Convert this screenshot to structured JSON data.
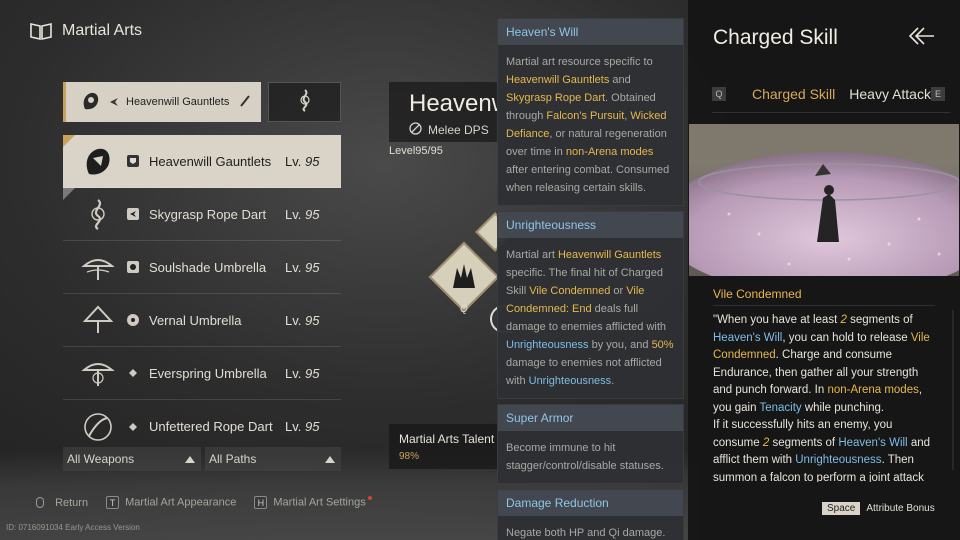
{
  "header": {
    "title": "Martial Arts"
  },
  "top_tab": {
    "label": "Heavenwill Gauntlets"
  },
  "weapons": [
    {
      "name": "Heavenwill Gauntlets",
      "lv_prefix": "Lv.",
      "lv": "95",
      "selected": true
    },
    {
      "name": "Skygrasp Rope Dart",
      "lv_prefix": "Lv.",
      "lv": "95"
    },
    {
      "name": "Soulshade Umbrella",
      "lv_prefix": "Lv.",
      "lv": "95"
    },
    {
      "name": "Vernal Umbrella",
      "lv_prefix": "Lv.",
      "lv": "95"
    },
    {
      "name": "Everspring Umbrella",
      "lv_prefix": "Lv.",
      "lv": "95"
    },
    {
      "name": "Unfettered Rope Dart",
      "lv_prefix": "Lv.",
      "lv": "95"
    }
  ],
  "filters": {
    "weapons": "All Weapons",
    "paths": "All Paths"
  },
  "hints": {
    "return": "Return",
    "appearance_key": "T",
    "appearance": "Martial Art Appearance",
    "settings_key": "H",
    "settings": "Martial Art Settings"
  },
  "build": "ID: 0716091034 Early Access Version",
  "center": {
    "title": "Heavenwill Gauntlets",
    "role": "Melee DPS",
    "level_label": "Level",
    "level_value": "95/95",
    "skill_key": "Q",
    "talent_label": "Martial Arts Talent",
    "talent_progress": "98%"
  },
  "tips": {
    "heavens_will": {
      "title": "Heaven's Will",
      "t1": "Martial art resource specific to ",
      "h1": "Heavenwill Gauntlets",
      "t2": " and ",
      "h2": "Skygrasp Rope Dart",
      "t3": ". Obtained through ",
      "h3": "Falcon's Pursuit",
      "t4": ", ",
      "h4": "Wicked Defiance",
      "t5": ", or natural regeneration over time in ",
      "h5": "non-Arena modes",
      "t6": " after entering combat. Consumed when releasing certain skills."
    },
    "unrighteousness": {
      "title": "Unrighteousness",
      "t1": "Martial art ",
      "h1": "Heavenwill Gauntlets",
      "t2": " specific. The final hit of Charged Skill ",
      "h2": "Vile Condemned",
      "t3": " or ",
      "h3": "Vile Condemned: End",
      "t4": " deals full damage to enemies afflicted with ",
      "h4": "Unrighteousness",
      "t5": " by you, and ",
      "h5": "50%",
      "t6": " damage to enemies not afflicted with ",
      "h6": "Unrighteousness",
      "t7": "."
    },
    "super_armor": {
      "title": "Super Armor",
      "body": "Become immune to hit stagger/control/disable statuses."
    },
    "damage_reduction": {
      "title": "Damage Reduction",
      "body": "Negate both HP and Qi damage."
    }
  },
  "right": {
    "title": "Charged Skill",
    "tab_key_left": "Q",
    "tab_active": "Charged Skill",
    "tab_other": "Heavy Attack",
    "tab_key_right": "E",
    "skill_name": "Vile Condemned",
    "desc": {
      "t1": "\"When you have at least ",
      "n1": "2",
      "t2": " segments of ",
      "b1": "Heaven's Will",
      "t3": ", you can hold to release ",
      "g1": "Vile Condemned",
      "t4": ". Charge and consume Endurance, then gather all your strength and punch forward. In ",
      "g2": "non-Arena modes",
      "t5": ", you gain ",
      "b2": "Tenacity",
      "t6": " while punching.",
      "t7": "If it successfully hits an enemy, you consume ",
      "n2": "2",
      "t8": " segments of ",
      "b3": "Heaven's Will",
      "t9": " and afflict them with ",
      "b4": "Unrighteousness",
      "t10": ". Then summon a falcon to perform a joint attack"
    },
    "foot_key": "Space",
    "foot_label": "Attribute Bonus"
  }
}
